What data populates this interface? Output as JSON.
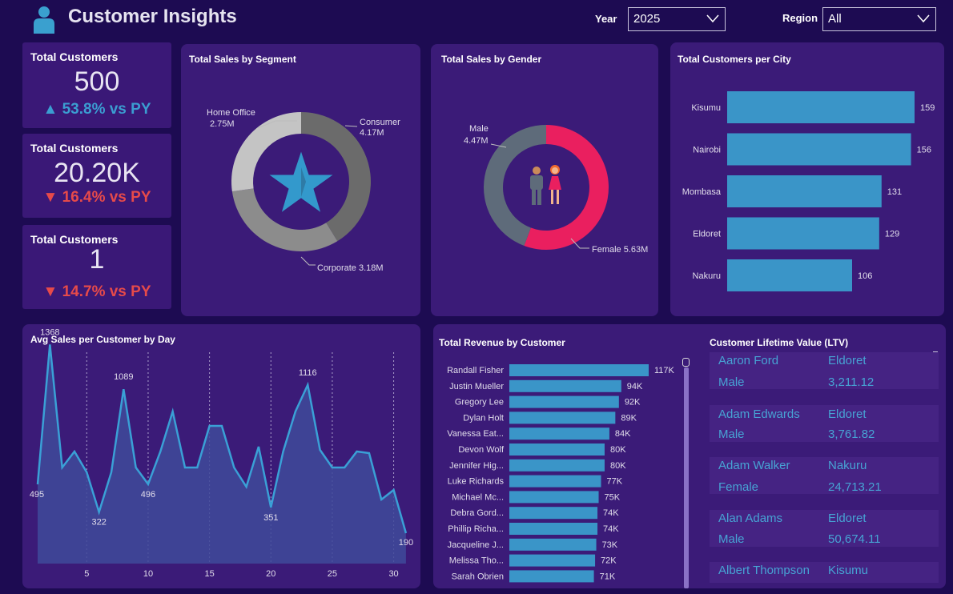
{
  "header": {
    "title": "Customer Insights",
    "year_label": "Year",
    "year_value": "2025",
    "region_label": "Region",
    "region_value": "All"
  },
  "kpis": [
    {
      "title": "Total Customers",
      "value": "500",
      "delta": "▲ 53.8% vs PY",
      "color": "#3b9dd1"
    },
    {
      "title": "Total Customers",
      "value": "20.20K",
      "delta": "▼ 16.4% vs PY",
      "color": "#e64a4a"
    },
    {
      "title": "Total Customers",
      "value": "1",
      "delta": "▼ 14.7% vs PY",
      "color": "#e64a4a"
    }
  ],
  "segment": {
    "title": "Total Sales by Segment",
    "labels": {
      "home": "Home Office",
      "home_val": "2.75M",
      "consumer": "Consumer",
      "consumer_val": "4.17M",
      "corporate": "Corporate 3.18M"
    }
  },
  "gender": {
    "title": "Total Sales by Gender",
    "male": "Male",
    "male_val": "4.47M",
    "female": "Female 5.63M"
  },
  "city": {
    "title": "Total Customers per City"
  },
  "day": {
    "title": "Avg Sales per Customer by Day"
  },
  "revenue": {
    "title": "Total Revenue by Customer"
  },
  "ltv": {
    "title": "Customer Lifetime Value (LTV)",
    "items": [
      {
        "name": "Aaron Ford",
        "city": "Eldoret",
        "gender": "Male",
        "value": "3,211.12"
      },
      {
        "name": "Adam Edwards",
        "city": "Eldoret",
        "gender": "Male",
        "value": "3,761.82"
      },
      {
        "name": "Adam Walker",
        "city": "Nakuru",
        "gender": "Female",
        "value": "24,713.21"
      },
      {
        "name": "Alan Adams",
        "city": "Eldoret",
        "gender": "Male",
        "value": "50,674.11"
      },
      {
        "name": "Albert Thompson",
        "city": "Kisumu",
        "gender": "",
        "value": ""
      }
    ]
  },
  "colors": {
    "bar": "#3a95c8",
    "pink": "#ea1f5f",
    "slate": "#5e6b7a",
    "bg": "#1d0b52",
    "card": "#3b1b78"
  },
  "chart_data": [
    {
      "type": "pie",
      "title": "Total Sales by Segment",
      "categories": [
        "Consumer",
        "Corporate",
        "Home Office"
      ],
      "values": [
        4.17,
        3.18,
        2.75
      ],
      "unit": "M"
    },
    {
      "type": "pie",
      "title": "Total Sales by Gender",
      "categories": [
        "Female",
        "Male"
      ],
      "values": [
        5.63,
        4.47
      ],
      "unit": "M"
    },
    {
      "type": "bar",
      "title": "Total Customers per City",
      "categories": [
        "Kisumu",
        "Nairobi",
        "Mombasa",
        "Eldoret",
        "Nakuru"
      ],
      "values": [
        159,
        156,
        131,
        129,
        106
      ]
    },
    {
      "type": "area",
      "title": "Avg Sales per Customer by Day",
      "x": [
        1,
        2,
        3,
        4,
        5,
        6,
        7,
        8,
        9,
        10,
        11,
        12,
        13,
        14,
        15,
        16,
        17,
        18,
        19,
        20,
        21,
        22,
        23,
        24,
        25,
        26,
        27,
        28,
        29,
        30,
        31
      ],
      "values": [
        495,
        1368,
        600,
        700,
        570,
        322,
        570,
        1089,
        600,
        496,
        700,
        950,
        600,
        600,
        860,
        860,
        600,
        480,
        730,
        351,
        700,
        950,
        1116,
        710,
        600,
        600,
        700,
        690,
        400,
        460,
        190
      ],
      "xticks": [
        5,
        10,
        15,
        20,
        25,
        30
      ],
      "labels": {
        "1": "495",
        "2": "1368",
        "6": "322",
        "8": "1089",
        "10": "496",
        "20": "351",
        "23": "1116",
        "31": "190"
      }
    },
    {
      "type": "bar",
      "title": "Total Revenue by Customer",
      "categories": [
        "Randall Fisher",
        "Justin Mueller",
        "Gregory Lee",
        "Dylan Holt",
        "Vanessa Eat...",
        "Devon Wolf",
        "Jennifer Hig...",
        "Luke Richards",
        "Michael Mc...",
        "Debra Gord...",
        "Phillip Richa...",
        "Jacqueline J...",
        "Melissa Tho...",
        "Sarah Obrien"
      ],
      "values": [
        117,
        94,
        92,
        89,
        84,
        80,
        80,
        77,
        75,
        74,
        74,
        73,
        72,
        71
      ],
      "value_labels": [
        "117K",
        "94K",
        "92K",
        "89K",
        "84K",
        "80K",
        "80K",
        "77K",
        "75K",
        "74K",
        "74K",
        "73K",
        "72K",
        "71K"
      ]
    }
  ]
}
